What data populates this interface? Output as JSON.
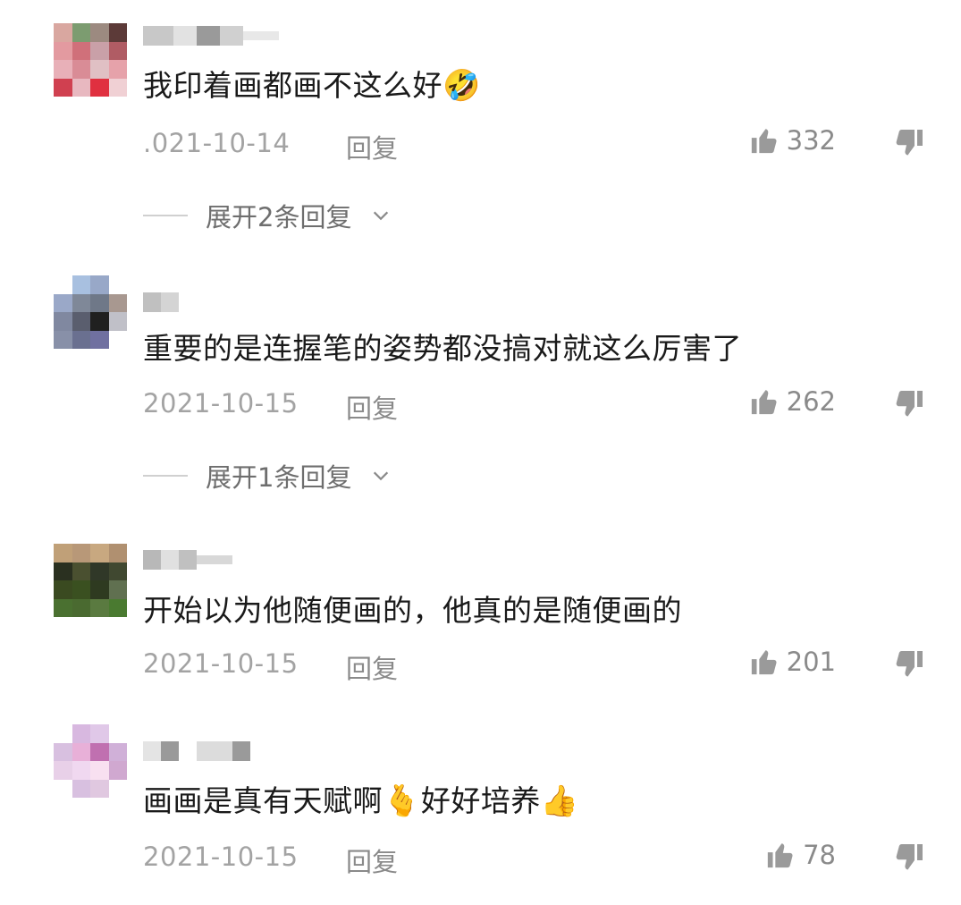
{
  "comments": [
    {
      "text": "我印着画都画不这么好",
      "emoji": "🤣",
      "date": ".021-10-14",
      "reply_label": "回复",
      "likes": "332",
      "expand_label": "展开2条回复"
    },
    {
      "text": "重要的是连握笔的姿势都没搞对就这么厉害了",
      "emoji": "",
      "date": "2021-10-15",
      "reply_label": "回复",
      "likes": "262",
      "expand_label": "展开1条回复"
    },
    {
      "text": "开始以为他随便画的，他真的是随便画的",
      "emoji": "",
      "date": "2021-10-15",
      "reply_label": "回复",
      "likes": "201",
      "expand_label": ""
    },
    {
      "text": "画画是真有天赋啊",
      "emoji": "🫰",
      "text2": "好好培养",
      "emoji2": "👍",
      "date": "2021-10-15",
      "reply_label": "回复",
      "likes": "78",
      "expand_label": ""
    }
  ],
  "icons": {
    "like": "thumbs-up-icon",
    "dislike": "thumbs-down-icon",
    "expand": "chevron-down-icon"
  },
  "colors": {
    "meta_text": "#a3a3a3",
    "icon": "#9a9a9a",
    "body_text": "#1a1a1a"
  }
}
